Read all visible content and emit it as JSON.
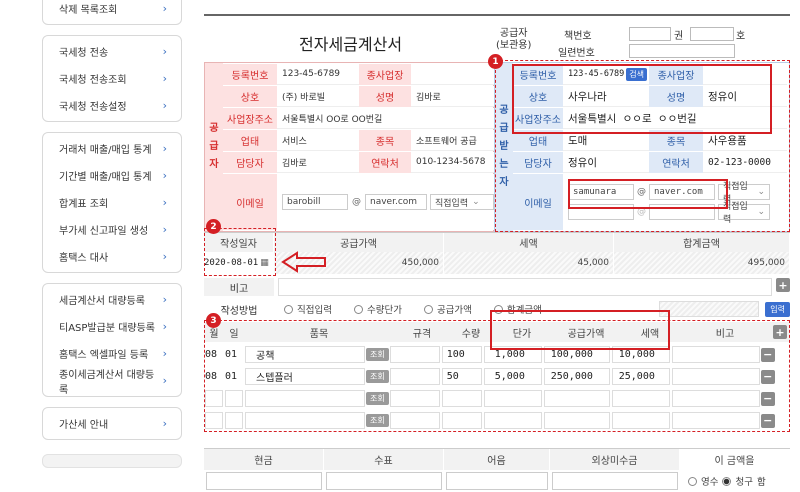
{
  "sidebar": {
    "groups": [
      [
        "삭제 목록조회"
      ],
      [
        "국세청 전송",
        "국세청 전송조회",
        "국세청 전송설정"
      ],
      [
        "거래처 매출/매입 통계",
        "기간별 매출/매입 통계",
        "합계표 조회",
        "부가세 신고파일 생성",
        "홈택스 대사"
      ],
      [
        "세금계산서 대량등록",
        "티ASP발급분 대량등록",
        "홈택스 엑셀파일 등록",
        "종이세금계산서 대량등록"
      ],
      [
        "가산세 안내"
      ]
    ],
    "chevron": "›"
  },
  "header": {
    "title": "전자세금계산서",
    "supplier_copy_l1": "공급자",
    "supplier_copy_l2": "(보관용)",
    "book_label": "책번호",
    "gwon": "권",
    "ho": "호",
    "serial_label": "일련번호"
  },
  "supplier": {
    "side": [
      "공",
      "급",
      "자"
    ],
    "reg_no_label": "등록번호",
    "reg_no": "123-45-6789",
    "branch_label": "종사업장",
    "name_label": "상호",
    "name": "(주) 바로빌",
    "ceo_label": "성명",
    "ceo": "김바로",
    "addr_label": "사업장주소",
    "addr": "서울특별시 OO로 OO번길",
    "biz_type_label": "업태",
    "biz_type": "서비스",
    "biz_item_label": "종목",
    "biz_item": "소프트웨어 공급",
    "manager_label": "담당자",
    "manager": "김바로",
    "phone_label": "연락처",
    "phone": "010-1234-5678",
    "email_label": "이메일",
    "email_id": "barobill",
    "email_at": "@",
    "email_domain": "naver.com",
    "email_select": "직접입력"
  },
  "receiver": {
    "side": [
      "공",
      "급",
      "받",
      "는",
      "자"
    ],
    "reg_no_label": "등록번호",
    "reg_no": "123-45-6789",
    "check_btn": "검색",
    "branch_label": "종사업장",
    "name_label": "상호",
    "name": "사우나라",
    "ceo_label": "성명",
    "ceo": "정유이",
    "addr_label": "사업장주소",
    "addr": "서울특별시 ㅇㅇ로 ㅇㅇ번길",
    "biz_type_label": "업태",
    "biz_type": "도매",
    "biz_item_label": "종목",
    "biz_item": "사우용품",
    "manager_label": "담당자",
    "manager": "정유이",
    "phone_label": "연락처",
    "phone": "02-123-0000",
    "email_label": "이메일",
    "email_id": "samunara",
    "email_at": "@",
    "email_domain": "naver.com",
    "email_select": "직접입력",
    "email_select2": "직접입력"
  },
  "amounts": {
    "date_label": "작성일자",
    "supply_label": "공급가액",
    "tax_label": "세액",
    "total_label": "합계금액",
    "date": "2020-08-01",
    "supply": "450,000",
    "tax": "45,000",
    "total": "495,000"
  },
  "note": {
    "label": "비고",
    "plus": "+"
  },
  "method": {
    "label": "작성방법",
    "options": [
      "직접입력",
      "수량단가",
      "공급가액",
      "합계금액"
    ],
    "input_btn": "입력"
  },
  "items": {
    "headers": {
      "month": "월",
      "day": "일",
      "name": "품목",
      "spec": "규격",
      "qty": "수량",
      "price": "단가",
      "supply": "공급가액",
      "tax": "세액",
      "note": "비고"
    },
    "lookup": "조회",
    "rows": [
      {
        "month": "08",
        "day": "01",
        "name": "공책",
        "qty": "100",
        "price": "1,000",
        "supply": "100,000",
        "tax": "10,000"
      },
      {
        "month": "08",
        "day": "01",
        "name": "스텝플러",
        "qty": "50",
        "price": "5,000",
        "supply": "250,000",
        "tax": "25,000"
      },
      {
        "month": "",
        "day": "",
        "name": "",
        "qty": "",
        "price": "",
        "supply": "",
        "tax": ""
      },
      {
        "month": "",
        "day": "",
        "name": "",
        "qty": "",
        "price": "",
        "supply": "",
        "tax": ""
      }
    ],
    "minus": "−",
    "plus": "+"
  },
  "payment": {
    "cash": "현금",
    "check": "수표",
    "bill": "어음",
    "credit": "외상미수금",
    "amount_label": "이 금액을",
    "receipt": "영수",
    "claim": "청구",
    "suffix": "함"
  },
  "badges": [
    "1",
    "2",
    "3"
  ],
  "colors": {
    "accent_red": "#d41f24",
    "supplier_bg": "#fde1e1",
    "receiver_bg": "#dfe9f7",
    "button_blue": "#3a6fd0"
  }
}
